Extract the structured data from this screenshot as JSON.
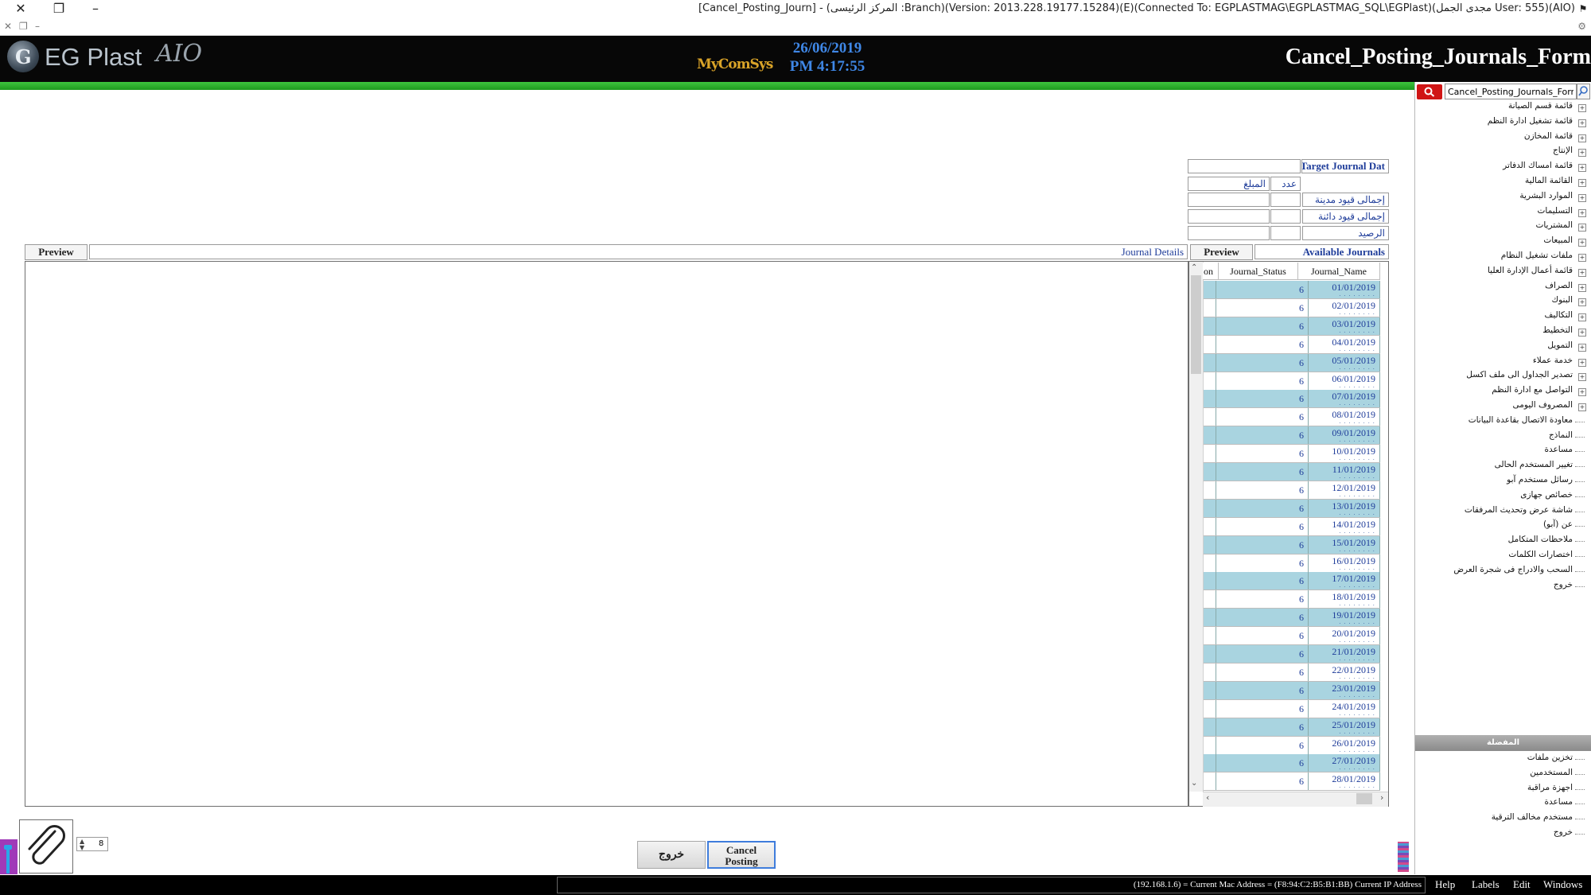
{
  "window": {
    "title": "[Cancel_Posting_Journ] - (المركز الرئيسى :Branch)(Version: 2013.228.19177.15284)(E)(Connected To: EGPLASTMAG\\EGPLASTMAG_SQL\\EGPlast)(مجدى الجمل User: 555)(AIO)"
  },
  "header": {
    "logo_mark": "G",
    "logo_text": "EG Plast",
    "logo_suffix": "AIO",
    "brand": "MyComSys",
    "date": "26/06/2019",
    "time": "PM 4:17:55",
    "form_title": "Cancel_Posting_Journals_Form"
  },
  "sidebar": {
    "search_value": "Cancel_Posting_Journals_Form",
    "items": [
      {
        "label": "قائمة قسم الصيانة",
        "expandable": true
      },
      {
        "label": "قائمة تشغيل ادارة النظم",
        "expandable": true
      },
      {
        "label": "قائمة المخازن",
        "expandable": true
      },
      {
        "label": "الإنتاج",
        "expandable": true
      },
      {
        "label": "قائمة امساك الدفاتر",
        "expandable": true
      },
      {
        "label": "القائمة المالية",
        "expandable": true
      },
      {
        "label": "الموارد البشرية",
        "expandable": true
      },
      {
        "label": "التسليمات",
        "expandable": true
      },
      {
        "label": "المشتريات",
        "expandable": true
      },
      {
        "label": "المبيعات",
        "expandable": true
      },
      {
        "label": "ملفات تشغيل النظام",
        "expandable": true
      },
      {
        "label": "قائمة أعمال الإدارة العليا",
        "expandable": true
      },
      {
        "label": "الصراف",
        "expandable": true
      },
      {
        "label": "البنوك",
        "expandable": true
      },
      {
        "label": "التكاليف",
        "expandable": true
      },
      {
        "label": "التخطيط",
        "expandable": true
      },
      {
        "label": "التمويل",
        "expandable": true
      },
      {
        "label": "خدمة عملاء",
        "expandable": true
      },
      {
        "label": "تصدير الجداول الى ملف اكسل",
        "expandable": true
      },
      {
        "label": "التواصل مع ادارة النظم",
        "expandable": true
      },
      {
        "label": "المصروف اليومى",
        "expandable": true
      },
      {
        "label": "معاودة الاتصال بقاعدة البيانات",
        "expandable": false
      },
      {
        "label": "النماذج",
        "expandable": false
      },
      {
        "label": "مساعدة",
        "expandable": false
      },
      {
        "label": "تغيير المستخدم الحالى",
        "expandable": false
      },
      {
        "label": "رسائل مستخدم آبو",
        "expandable": false
      },
      {
        "label": "خصائص جهازى",
        "expandable": false
      },
      {
        "label": "شاشة عرض وتحديث المرفقات",
        "expandable": false
      },
      {
        "label": "عن (آبو)",
        "expandable": false
      },
      {
        "label": "ملاحظات المتكامل",
        "expandable": false
      },
      {
        "label": "اختصارات الكلمات",
        "expandable": false
      },
      {
        "label": "السحب والادراج فى شجرة العرض",
        "expandable": false
      },
      {
        "label": "خروج",
        "expandable": false
      }
    ],
    "favorites_header": "المفضلة",
    "favorites": [
      {
        "label": "تخزين ملفات"
      },
      {
        "label": "المستخدمين"
      },
      {
        "label": "اجهزة مراقبة"
      },
      {
        "label": "مساعدة"
      },
      {
        "label": "مستخدم مخالف الترقية"
      },
      {
        "label": "خروج"
      }
    ]
  },
  "summary": {
    "target_label": "Target Journal Dat",
    "count_header": "عدد",
    "amount_header": "المبلغ",
    "rows": [
      {
        "label": "إجمالى قيود مدينة"
      },
      {
        "label": "إجمالى قيود دائنة"
      },
      {
        "label": "الرصيد"
      }
    ]
  },
  "details": {
    "preview_label": "Preview",
    "title": "Journal Details"
  },
  "journals": {
    "preview_label": "Preview",
    "title": "Available Journals",
    "col_extra": "on",
    "col_status": "Journal_Status",
    "col_name": "Journal_Name",
    "rows": [
      {
        "name": "01/01/2019",
        "status": "6"
      },
      {
        "name": "02/01/2019",
        "status": "6"
      },
      {
        "name": "03/01/2019",
        "status": "6"
      },
      {
        "name": "04/01/2019",
        "status": "6"
      },
      {
        "name": "05/01/2019",
        "status": "6"
      },
      {
        "name": "06/01/2019",
        "status": "6"
      },
      {
        "name": "07/01/2019",
        "status": "6"
      },
      {
        "name": "08/01/2019",
        "status": "6"
      },
      {
        "name": "09/01/2019",
        "status": "6"
      },
      {
        "name": "10/01/2019",
        "status": "6"
      },
      {
        "name": "11/01/2019",
        "status": "6"
      },
      {
        "name": "12/01/2019",
        "status": "6"
      },
      {
        "name": "13/01/2019",
        "status": "6"
      },
      {
        "name": "14/01/2019",
        "status": "6"
      },
      {
        "name": "15/01/2019",
        "status": "6"
      },
      {
        "name": "16/01/2019",
        "status": "6"
      },
      {
        "name": "17/01/2019",
        "status": "6"
      },
      {
        "name": "18/01/2019",
        "status": "6"
      },
      {
        "name": "19/01/2019",
        "status": "6"
      },
      {
        "name": "20/01/2019",
        "status": "6"
      },
      {
        "name": "21/01/2019",
        "status": "6"
      },
      {
        "name": "22/01/2019",
        "status": "6"
      },
      {
        "name": "23/01/2019",
        "status": "6"
      },
      {
        "name": "24/01/2019",
        "status": "6"
      },
      {
        "name": "25/01/2019",
        "status": "6"
      },
      {
        "name": "26/01/2019",
        "status": "6"
      },
      {
        "name": "27/01/2019",
        "status": "6"
      },
      {
        "name": "28/01/2019",
        "status": "6"
      }
    ]
  },
  "footer": {
    "attachment_count": "8",
    "exit_label": "خروج",
    "cancel_line1": "Cancel",
    "cancel_line2": "Posting"
  },
  "statusbar": {
    "text": "(192.168.1.6) = Current Mac Address = (F8:94:C2:B5:B1:BB) Current IP Address",
    "menu": [
      "Help",
      "Labels",
      "Edit",
      "Windows"
    ]
  },
  "colors": {
    "header_bg": "#070707",
    "accent_green": "#2eb32e",
    "row_highlight": "#a9d4e0",
    "label_blue": "#1f3d9a",
    "search_red": "#d01515"
  }
}
